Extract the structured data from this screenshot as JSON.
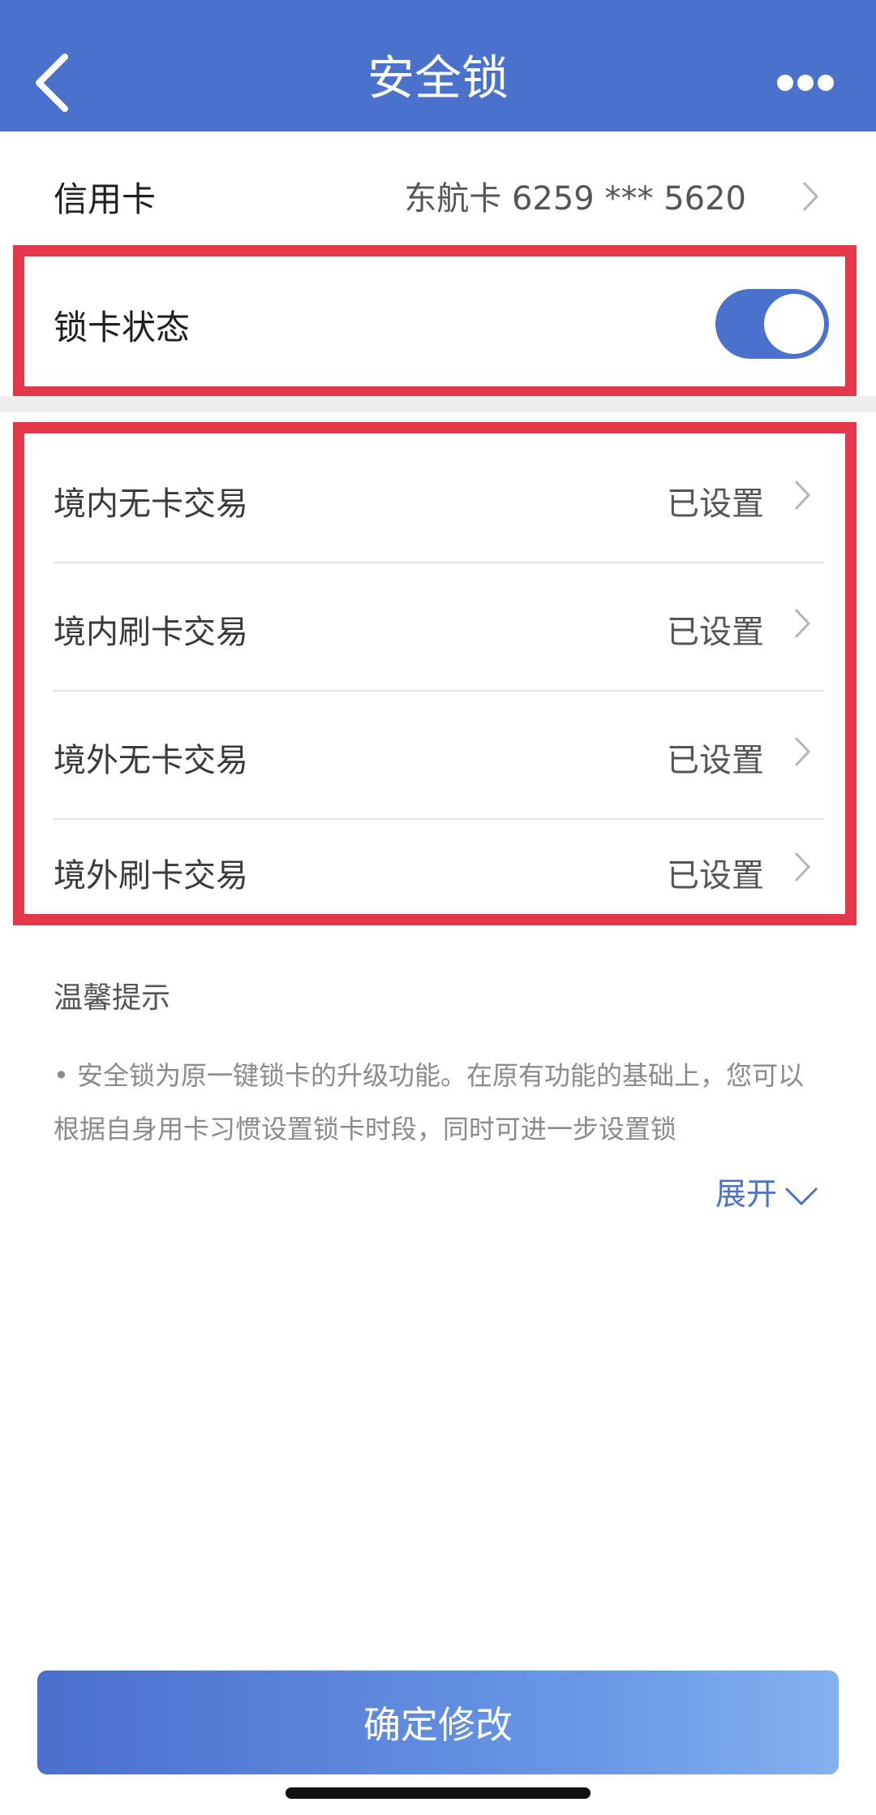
{
  "header": {
    "title": "安全锁",
    "back_icon": "chevron-left-icon",
    "more_icon": "ellipsis-icon",
    "color": "#4a71cc"
  },
  "card": {
    "label": "信用卡",
    "value": "东航卡  6259 *** 5620"
  },
  "lock": {
    "label": "锁卡状态",
    "enabled": true
  },
  "transactions": [
    {
      "label": "境内无卡交易",
      "status": "已设置"
    },
    {
      "label": "境内刷卡交易",
      "status": "已设置"
    },
    {
      "label": "境外无卡交易",
      "status": "已设置"
    },
    {
      "label": "境外刷卡交易",
      "status": "已设置"
    }
  ],
  "tips": {
    "title": "温馨提示",
    "text": "• 安全锁为原一键锁卡的升级功能。在原有功能的基础上，您可以根据自身用卡习惯设置锁卡时段，同时可进一步设置锁",
    "expand_label": "展开"
  },
  "footer": {
    "confirm_label": "确定修改"
  },
  "highlight_color": "#e3374a"
}
